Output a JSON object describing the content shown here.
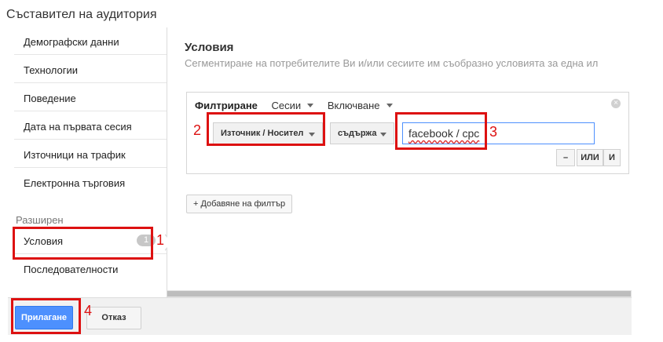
{
  "title": "Съставител на аудитория",
  "sidebar": {
    "items": [
      {
        "label": "Демографски данни"
      },
      {
        "label": "Технологии"
      },
      {
        "label": "Поведение"
      },
      {
        "label": "Дата на първата сесия"
      },
      {
        "label": "Източници на трафик"
      },
      {
        "label": "Електронна търговия"
      }
    ],
    "section_label": "Разширен",
    "advanced": [
      {
        "label": "Условия",
        "badge": "1"
      },
      {
        "label": "Последователности"
      }
    ]
  },
  "content": {
    "title": "Условия",
    "description": "Сегментиране на потребителите Ви и/или сесиите им съобразно условията за една ил",
    "filter": {
      "heading": "Филтриране",
      "scope": "Сесии",
      "mode": "Включване",
      "dimension": "Източник / Носител",
      "operator": "съдържа",
      "value": "facebook / cpc",
      "minus_label": "–",
      "or_label": "ИЛИ",
      "and_label": "И"
    },
    "add_filter_label": "+ Добавяне на филтър"
  },
  "footer": {
    "apply_label": "Прилагане",
    "cancel_label": "Отказ"
  },
  "annotations": [
    "1",
    "2",
    "3",
    "4"
  ],
  "colors": {
    "accent": "#4d90fe",
    "annotation": "#dd1111"
  }
}
